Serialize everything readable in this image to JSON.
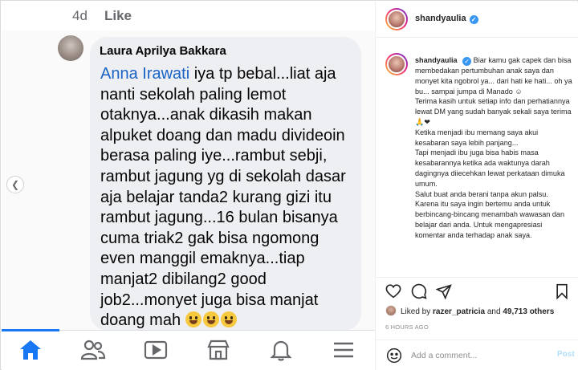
{
  "screenshot": {
    "time": "4d",
    "like": "Like",
    "comment": {
      "name": "Laura Aprilya Bakkara",
      "mention": "Anna Irawati",
      "text": " iya tp bebal...liat aja nanti sekolah paling lemot otaknya...anak dikasih makan alpuket doang dan madu divideoin berasa paling iye...rambut sebji, rambut jagung yg di sekolah dasar aja belajar tanda2 kurang gizi itu rambut jagung...16 bulan bisanya cuma triak2 gak bisa ngomong even manggil emaknya...tiap manjat2 dibilang2 good job2...monyet juga bisa manjat doang mah",
      "emoji_count": 3
    },
    "nav_icons": [
      "home-icon",
      "friends-icon",
      "watch-icon",
      "marketplace-icon",
      "bell-icon",
      "menu-icon"
    ]
  },
  "post": {
    "username": "shandyaulia",
    "verified_mark": "✓",
    "caption_lines": [
      "Biar kamu gak capek dan bisa membedakan pertumbuhan anak saya dan monyet kita ngobrol ya... dari hati ke hati... oh ya bu... sampai jumpa di Manado ☺",
      "Terima kasih untuk setiap info dan perhatiannya lewat DM yang sudah banyak sekali saya terima 🙏❤",
      "Ketika menjadi ibu memang saya akui kesabaran saya lebih panjang...",
      "Tapi menjadi ibu juga bisa habis masa kesabarannya ketika ada waktunya darah dagingnya diiecehkan lewat perkataan dimuka umum.",
      "Salut buat anda berani tanpa akun palsu. Karena itu saya ingin bertemu anda untuk berbincang-bincang menambah wawasan dan belajar dari anda. Untuk mengapresiasi komentar anda terhadap anak saya."
    ],
    "liked_by_prefix": "Liked by",
    "liked_by_user": "razer_patricia",
    "liked_by_and": "and",
    "likes_count": "49,713 others",
    "time_ago": "6 HOURS AGO",
    "comment_placeholder": "Add a comment...",
    "post_label": "Post"
  },
  "colors": {
    "facebook_blue": "#1877f2",
    "mention_blue": "#1a63c6",
    "verified_blue": "#3897f0",
    "post_disabled": "#b2dffc"
  }
}
